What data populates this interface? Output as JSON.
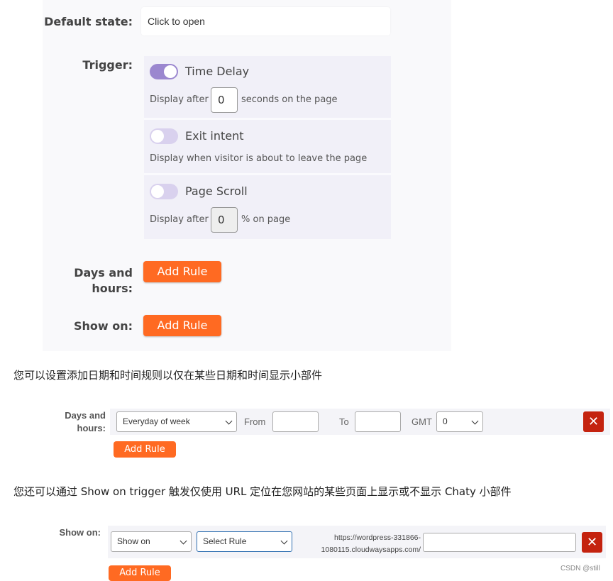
{
  "panel": {
    "default_state_label": "Default state:",
    "default_state_value": "Click to open",
    "trigger_label": "Trigger:",
    "triggers": [
      {
        "title": "Time Delay",
        "enabled": true,
        "prefix": "Display after",
        "value": "0",
        "suffix": "seconds on the page"
      },
      {
        "title": "Exit intent",
        "enabled": false,
        "description": "Display when visitor is about to leave the page"
      },
      {
        "title": "Page Scroll",
        "enabled": false,
        "prefix": "Display after",
        "value": "0",
        "suffix": "% on page"
      }
    ],
    "days_hours_label_line1": "Days and",
    "days_hours_label_line2": "hours:",
    "add_rule_label": "Add Rule",
    "show_on_label": "Show on:"
  },
  "text1": "您可以设置添加日期和时间规则以仅在某些日期和时间显示小部件",
  "days_rule": {
    "label_line1": "Days and",
    "label_line2": "hours:",
    "day_select": "Everyday of week",
    "from_label": "From",
    "to_label": "To",
    "gmt_label": "GMT",
    "gmt_select": "0",
    "delete_symbol": "✕",
    "add_rule_label": "Add Rule"
  },
  "text2": "您还可以通过 Show on trigger 触发仅使用 URL 定位在您网站的某些页面上显示或不显示 Chaty 小部件",
  "show_rule": {
    "label": "Show on:",
    "show_select": "Show on",
    "rule_select": "Select Rule",
    "url_line1": "https://wordpress-331866-",
    "url_line2": "1080115.cloudwaysapps.com/",
    "delete_symbol": "✕",
    "add_rule_label": "Add Rule"
  },
  "watermark": "CSDN @still",
  "colors": {
    "accent": "#ff6a22",
    "toggle_on": "#9b87cf",
    "toggle_off": "#d9d1ee",
    "delete": "#c4230f"
  }
}
